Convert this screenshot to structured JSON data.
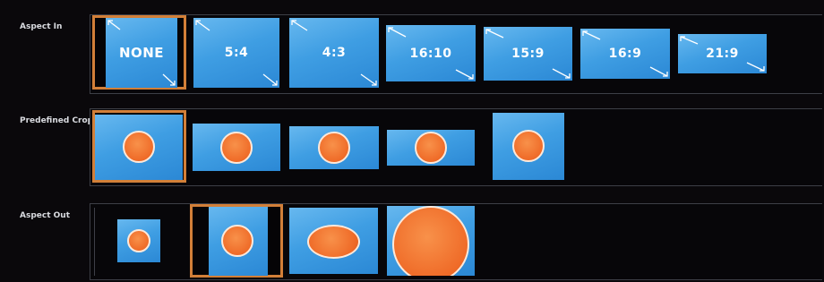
{
  "rows": {
    "aspect_in": {
      "label": "Aspect In"
    },
    "predefined_crop": {
      "label": "Predefined Crop"
    },
    "aspect_out": {
      "label": "Aspect Out"
    }
  },
  "aspect_in_options": [
    {
      "label": "NONE",
      "selected": true
    },
    {
      "label": "5:4",
      "selected": false
    },
    {
      "label": "4:3",
      "selected": false
    },
    {
      "label": "16:10",
      "selected": false
    },
    {
      "label": "15:9",
      "selected": false
    },
    {
      "label": "16:9",
      "selected": false
    },
    {
      "label": "21:9",
      "selected": false
    }
  ],
  "predefined_crop_selected_index": 0,
  "aspect_out_selected_index": 1,
  "colors": {
    "selection_border": "#d27f38",
    "tile_blue": "#3f9ee3",
    "circle_orange": "#ef6b28",
    "background": "#0a080b"
  }
}
